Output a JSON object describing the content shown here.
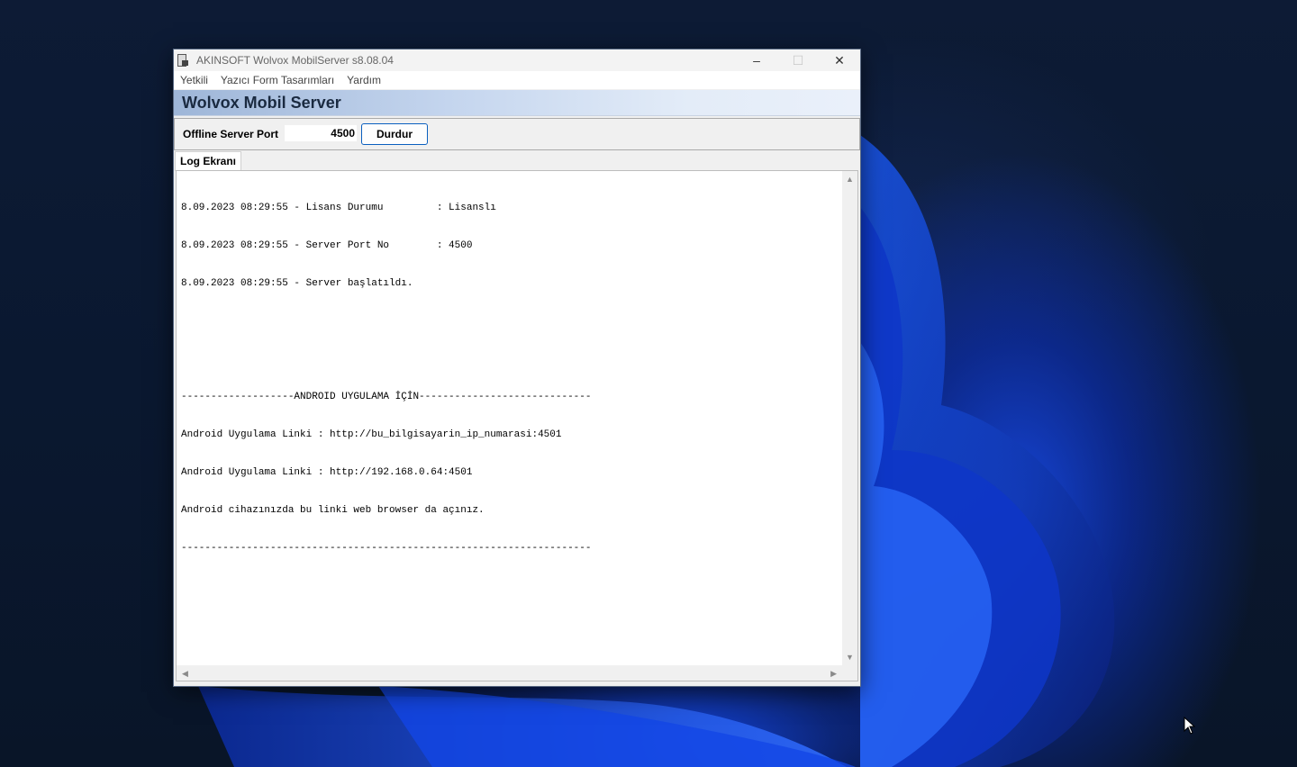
{
  "window": {
    "title": "AKINSOFT Wolvox MobilServer s8.08.04",
    "controls": {
      "minimize": "–",
      "maximize": "☐",
      "close": "✕"
    }
  },
  "menu": {
    "items": [
      "Yetkili",
      "Yazıcı Form Tasarımları",
      "Yardım"
    ]
  },
  "banner": {
    "title": "Wolvox Mobil Server"
  },
  "toolbar": {
    "port_label": "Offline Server Port",
    "port_value": "4500",
    "stop_label": "Durdur"
  },
  "tabs": {
    "log_label": "Log Ekranı"
  },
  "log": {
    "lines": [
      "8.09.2023 08:29:55 - Lisans Durumu         : Lisanslı",
      "8.09.2023 08:29:55 - Server Port No        : 4500",
      "8.09.2023 08:29:55 - Server başlatıldı.",
      "",
      "",
      "-------------------ANDROID UYGULAMA İÇİN-----------------------------",
      "Android Uygulama Linki : http://bu_bilgisayarin_ip_numarasi:4501",
      "Android Uygulama Linki : http://192.168.0.64:4501",
      "Android cihazınızda bu linki web browser da açınız.",
      "---------------------------------------------------------------------"
    ]
  },
  "icons": {
    "scroll_up": "▲",
    "scroll_down": "▼",
    "scroll_left": "◀",
    "scroll_right": "▶"
  },
  "colors": {
    "banner_start": "#9eb6d8",
    "banner_end": "#eaf0fa",
    "button_border": "#0a5fbf"
  }
}
